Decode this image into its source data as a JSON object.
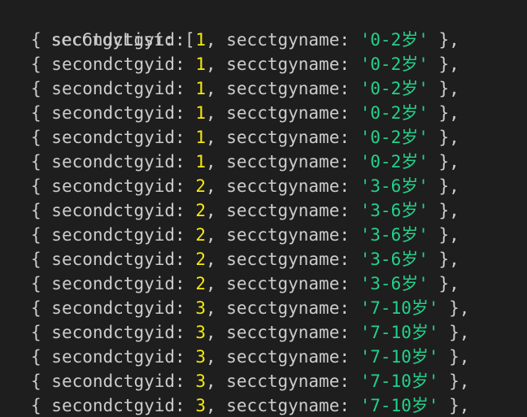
{
  "colors": {
    "background": "#1e1e1e",
    "text": "#cccccc",
    "number": "#f5e90f",
    "string": "#23d18b"
  },
  "header": "secCtgyList: [",
  "keys": {
    "id_key": "secondctgyid",
    "name_key": "secctgyname"
  },
  "punct": {
    "open": "{ ",
    "colon": ": ",
    "comma": ", ",
    "close": " },"
  },
  "rows": [
    {
      "id": "1",
      "name": "'0-2岁'"
    },
    {
      "id": "1",
      "name": "'0-2岁'"
    },
    {
      "id": "1",
      "name": "'0-2岁'"
    },
    {
      "id": "1",
      "name": "'0-2岁'"
    },
    {
      "id": "1",
      "name": "'0-2岁'"
    },
    {
      "id": "1",
      "name": "'0-2岁'"
    },
    {
      "id": "2",
      "name": "'3-6岁'"
    },
    {
      "id": "2",
      "name": "'3-6岁'"
    },
    {
      "id": "2",
      "name": "'3-6岁'"
    },
    {
      "id": "2",
      "name": "'3-6岁'"
    },
    {
      "id": "2",
      "name": "'3-6岁'"
    },
    {
      "id": "3",
      "name": "'7-10岁'"
    },
    {
      "id": "3",
      "name": "'7-10岁'"
    },
    {
      "id": "3",
      "name": "'7-10岁'"
    },
    {
      "id": "3",
      "name": "'7-10岁'"
    },
    {
      "id": "3",
      "name": "'7-10岁'"
    }
  ]
}
